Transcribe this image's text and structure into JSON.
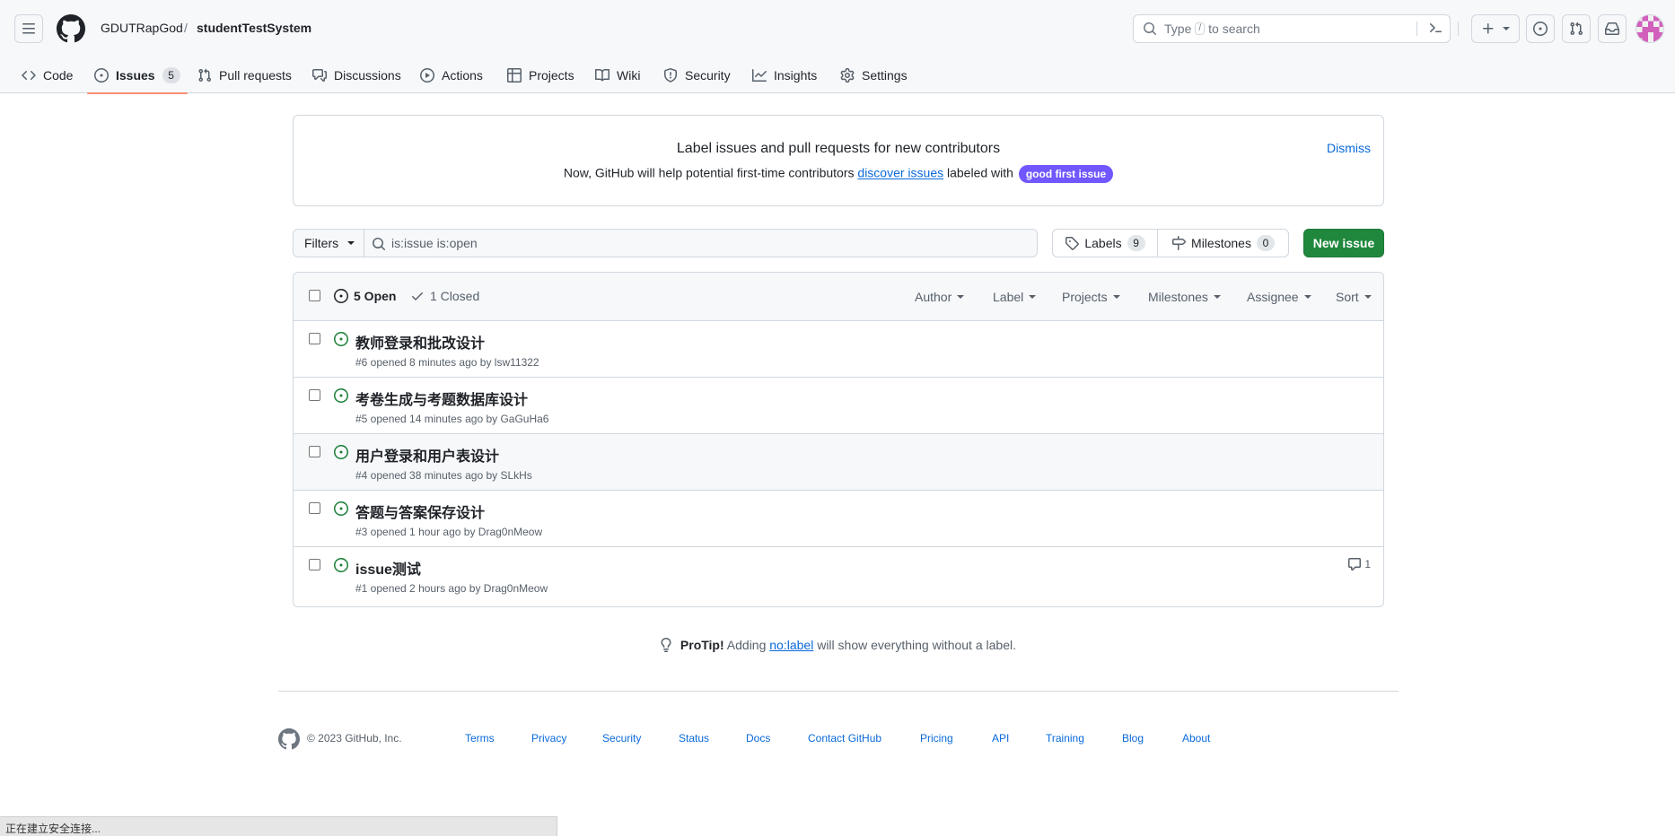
{
  "header": {
    "owner": "GDUTRapGod",
    "separator": "/",
    "repo": "studentTestSystem",
    "search_prefix": "Type",
    "search_key": "/",
    "search_suffix": "to search"
  },
  "tabs": [
    {
      "label": "Code",
      "icon": "code-icon"
    },
    {
      "label": "Issues",
      "icon": "issue-opened-icon",
      "count": "5"
    },
    {
      "label": "Pull requests",
      "icon": "git-pull-request-icon"
    },
    {
      "label": "Discussions",
      "icon": "comment-discussion-icon"
    },
    {
      "label": "Actions",
      "icon": "play-icon"
    },
    {
      "label": "Projects",
      "icon": "table-icon"
    },
    {
      "label": "Wiki",
      "icon": "book-icon"
    },
    {
      "label": "Security",
      "icon": "shield-icon"
    },
    {
      "label": "Insights",
      "icon": "graph-icon"
    },
    {
      "label": "Settings",
      "icon": "gear-icon"
    }
  ],
  "banner": {
    "title": "Label issues and pull requests for new contributors",
    "text_before": "Now, GitHub will help potential first-time contributors",
    "link": "discover issues",
    "text_after": "labeled with",
    "label": "good first issue",
    "label_color": "#7057ff",
    "dismiss": "Dismiss"
  },
  "filters": {
    "filters_label": "Filters",
    "query": "is:issue is:open",
    "labels_label": "Labels",
    "labels_count": "9",
    "milestones_label": "Milestones",
    "milestones_count": "0",
    "new_issue": "New issue",
    "new_issue_color": "#1f883d"
  },
  "list": {
    "open_label": "5 Open",
    "closed_label": "1 Closed",
    "facets": [
      "Author",
      "Label",
      "Projects",
      "Milestones",
      "Assignee",
      "Sort"
    ],
    "issues": [
      {
        "title": "教师登录和批改设计",
        "meta": "#6 opened 8 minutes ago by lsw11322"
      },
      {
        "title": "考卷生成与考题数据库设计",
        "meta": "#5 opened 14 minutes ago by GaGuHa6"
      },
      {
        "title": "用户登录和用户表设计",
        "meta": "#4 opened 38 minutes ago by SLkHs"
      },
      {
        "title": "答题与答案保存设计",
        "meta": "#3 opened 1 hour ago by Drag0nMeow"
      },
      {
        "title": "issue测试",
        "meta": "#1 opened 2 hours ago by Drag0nMeow",
        "comments": "1"
      }
    ]
  },
  "protip": {
    "label": "ProTip!",
    "before": "Adding",
    "link": "no:label",
    "after": "will show everything without a label."
  },
  "footer": {
    "copyright": "© 2023 GitHub, Inc.",
    "links": [
      "Terms",
      "Privacy",
      "Security",
      "Status",
      "Docs",
      "Contact GitHub",
      "Pricing",
      "API",
      "Training",
      "Blog",
      "About"
    ]
  },
  "statusbar": {
    "text": "正在建立安全连接..."
  }
}
